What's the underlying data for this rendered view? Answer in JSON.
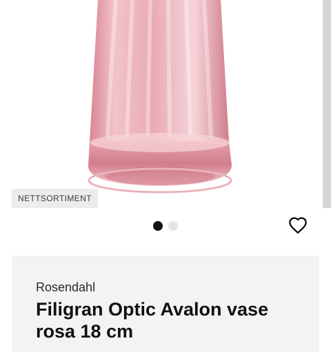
{
  "gallery": {
    "badge": "NETTSORTIMENT",
    "slide_count": 2,
    "active_slide": 1
  },
  "product": {
    "brand": "Rosendahl",
    "title": "Filigran Optic Avalon vase rosa 18 cm"
  },
  "icons": {
    "favorite": "heart-outline-icon"
  },
  "colors": {
    "glass_tint": "#e8a3ae",
    "dot_active": "#111111",
    "dot_inactive": "#e4e4e4",
    "card_background": "#f5f3f2"
  }
}
